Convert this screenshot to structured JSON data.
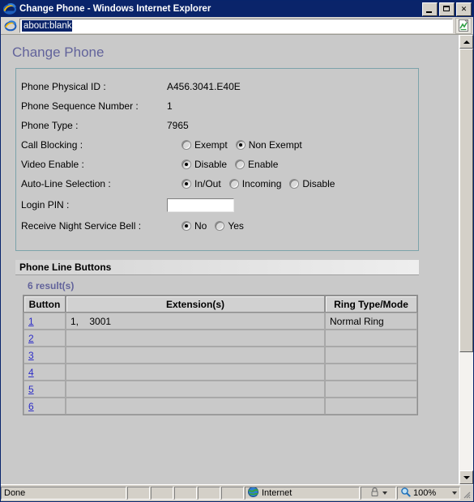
{
  "window": {
    "title": "Change Phone - Windows Internet Explorer",
    "ie_logo_icon": "ie-logo-icon",
    "minimize_label": "Minimize",
    "maximize_label": "Maximize",
    "close_label": "Close",
    "close_glyph": "✕"
  },
  "address_bar": {
    "page_icon": "ie-page-icon",
    "url": "about:blank",
    "go_icon": "go-refresh-icon"
  },
  "page": {
    "title": "Change Phone",
    "accent_color": "#62639b",
    "panel_border_color": "#7ca3aa",
    "link_color": "#2c2cc8"
  },
  "form": {
    "fields": [
      {
        "label": "Phone Physical ID :",
        "value": "A456.3041.E40E"
      },
      {
        "label": "Phone Sequence Number :",
        "value": "1"
      },
      {
        "label": "Phone Type :",
        "value": "7965"
      }
    ],
    "call_blocking": {
      "label": "Call Blocking :",
      "options": [
        {
          "label": "Exempt",
          "checked": false
        },
        {
          "label": "Non Exempt",
          "checked": true
        }
      ]
    },
    "video_enable": {
      "label": "Video Enable :",
      "options": [
        {
          "label": "Disable",
          "checked": true
        },
        {
          "label": "Enable",
          "checked": false
        }
      ]
    },
    "auto_line_selection": {
      "label": "Auto-Line Selection :",
      "options": [
        {
          "label": "In/Out",
          "checked": true
        },
        {
          "label": "Incoming",
          "checked": false
        },
        {
          "label": "Disable",
          "checked": false
        }
      ]
    },
    "login_pin": {
      "label": "Login PIN :",
      "value": "",
      "placeholder": ""
    },
    "night_service_bell": {
      "label": "Receive Night Service Bell :",
      "options": [
        {
          "label": "No",
          "checked": true
        },
        {
          "label": "Yes",
          "checked": false
        }
      ]
    }
  },
  "section": {
    "title": "Phone Line Buttons",
    "results": "6 result(s)"
  },
  "table": {
    "columns": [
      "Button",
      "Extension(s)",
      "Ring Type/Mode"
    ],
    "rows": [
      {
        "button": "1",
        "extensions": "1,    3001",
        "ring": "Normal Ring"
      },
      {
        "button": "2",
        "extensions": "",
        "ring": ""
      },
      {
        "button": "3",
        "extensions": "",
        "ring": ""
      },
      {
        "button": "4",
        "extensions": "",
        "ring": ""
      },
      {
        "button": "5",
        "extensions": "",
        "ring": ""
      },
      {
        "button": "6",
        "extensions": "",
        "ring": ""
      }
    ]
  },
  "status_bar": {
    "status": "Done",
    "zone_icon": "globe-icon",
    "zone": "Internet",
    "security_icon": "lock-icon",
    "zoom_icon": "magnifier-icon",
    "zoom_level": "100%"
  }
}
